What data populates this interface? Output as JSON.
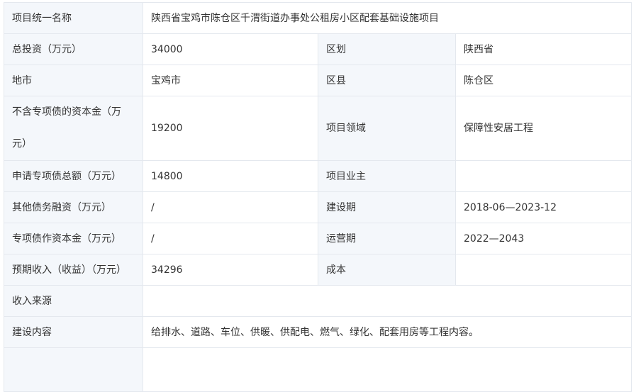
{
  "project": {
    "name_label": "项目统一名称",
    "name_value": "陕西省宝鸡市陈仓区千渭街道办事处公租房小区配套基础设施项目",
    "investment_label": "总投资（万元）",
    "investment_value": "34000",
    "region_label": "区划",
    "region_value": "陕西省",
    "city_label": "地市",
    "city_value": "宝鸡市",
    "county_label": "区县",
    "county_value": "陈仓区",
    "capital_label": "不含专项债的资本金（万元）",
    "capital_value": "19200",
    "field_label": "项目领域",
    "field_value": "保障性安居工程",
    "bond_total_label": "申请专项债总额（万元）",
    "bond_total_value": "14800",
    "owner_label": "项目业主",
    "owner_value": "",
    "other_debt_label": "其他债务融资（万元）",
    "other_debt_value": "/",
    "construction_period_label": "建设期",
    "construction_period_value": "2018-06—2023-12",
    "bond_capital_label": "专项债作资本金（万元）",
    "bond_capital_value": "/",
    "operation_period_label": "运营期",
    "operation_period_value": "2022—2043",
    "expected_income_label": "预期收入（收益）（万元）",
    "expected_income_value": "34296",
    "cost_label": "成本",
    "cost_value": "",
    "income_source_label": "收入来源",
    "income_source_value": "",
    "content_label": "建设内容",
    "content_value": "给排水、道路、车位、供暖、供配电、燃气、绿化、配套用房等工程内容。"
  }
}
